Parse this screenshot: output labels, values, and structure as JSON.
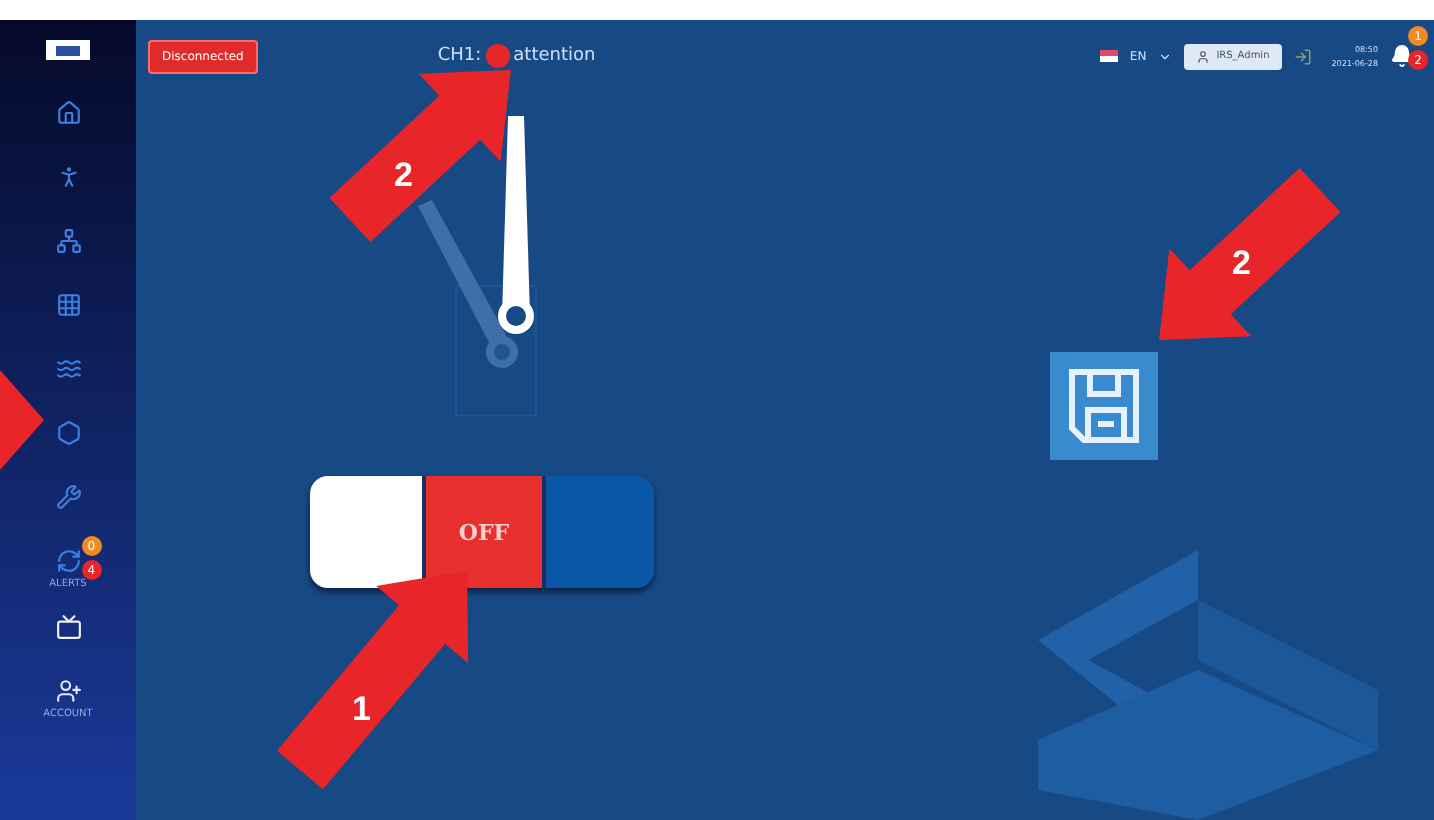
{
  "header": {
    "status_badge": "Disconnected",
    "channel": {
      "label": "CH1:",
      "status": "attention",
      "color": "#e8262a"
    },
    "language": "EN",
    "user": "IRS_Admin",
    "time": "08:50",
    "date": "2021-06-28",
    "notifications": [
      {
        "count": "1",
        "color": "#f08a24"
      },
      {
        "count": "2",
        "color": "#e8262a"
      }
    ]
  },
  "sidebar": {
    "items": [
      {
        "kind": "home"
      },
      {
        "kind": "figure"
      },
      {
        "kind": "network"
      },
      {
        "kind": "grid"
      },
      {
        "kind": "waves"
      },
      {
        "kind": "hexagon"
      },
      {
        "kind": "tools"
      },
      {
        "kind": "alerts",
        "label": "ALERTS",
        "badges": [
          {
            "count": "0",
            "color": "#f08a24"
          },
          {
            "count": "4",
            "color": "#e8262a"
          }
        ]
      },
      {
        "kind": "monitor"
      },
      {
        "kind": "users",
        "label": "ACCOUNT"
      }
    ]
  },
  "toggle": {
    "label": "OFF",
    "on": false
  },
  "annotations": [
    {
      "kind": "channel",
      "number": "2"
    },
    {
      "kind": "save",
      "number": "2"
    },
    {
      "kind": "toggle",
      "number": "1"
    },
    {
      "kind": "sidebar"
    }
  ]
}
